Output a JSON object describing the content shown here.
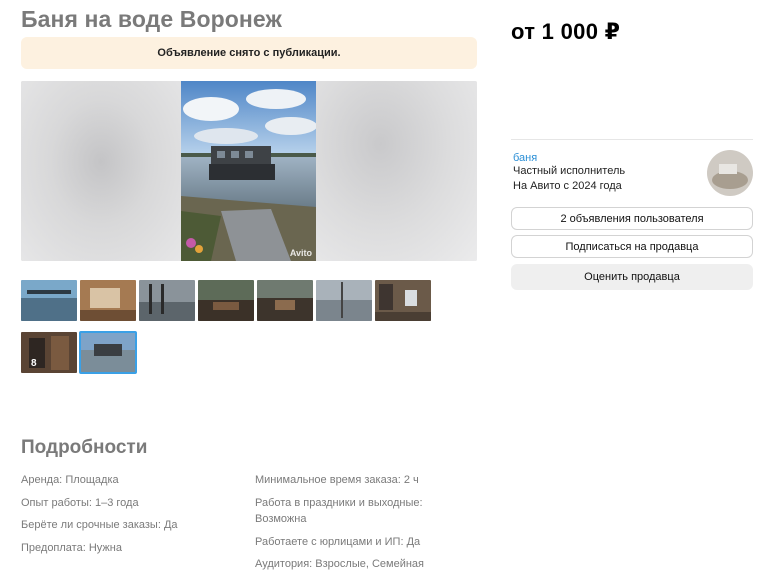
{
  "listing": {
    "title": "Баня на воде Воронеж",
    "banner": "Объявление снято с публикации.",
    "watermark": "Avito"
  },
  "gallery": {
    "thumbnails": [
      {
        "id": "t1"
      },
      {
        "id": "t2"
      },
      {
        "id": "t3"
      },
      {
        "id": "t4"
      },
      {
        "id": "t5"
      },
      {
        "id": "t6"
      },
      {
        "id": "t7"
      },
      {
        "id": "t8",
        "badge": "8"
      },
      {
        "id": "t9",
        "selected": true
      }
    ]
  },
  "details": {
    "heading": "Подробности",
    "left": [
      {
        "key": "Аренда:",
        "value": "Площадка"
      },
      {
        "key": "Опыт работы:",
        "value": "1–3 года"
      },
      {
        "key": "Берёте ли срочные заказы:",
        "value": "Да"
      },
      {
        "key": "Предоплата:",
        "value": "Нужна"
      }
    ],
    "right": [
      {
        "key": "Минимальное время заказа:",
        "value": "2 ч"
      },
      {
        "key": "Работа в праздники и выходные:",
        "value": "Возможна"
      },
      {
        "key": "Работаете с юрлицами и ИП:",
        "value": "Да"
      },
      {
        "key": "Аудитория:",
        "value": "Взрослые, Семейная"
      }
    ]
  },
  "sidebar": {
    "price": "от 1 000 ₽",
    "seller_name": "баня",
    "seller_type": "Частный исполнитель",
    "seller_since": "На Авито с 2024 года",
    "btn_listings": "2 объявления пользователя",
    "btn_subscribe": "Подписаться на продавца",
    "btn_rate": "Оценить продавца"
  },
  "colors": {
    "banner_bg": "#fdf1e0",
    "link": "#2b8fd6",
    "selected_outline": "#3aa0e6"
  }
}
